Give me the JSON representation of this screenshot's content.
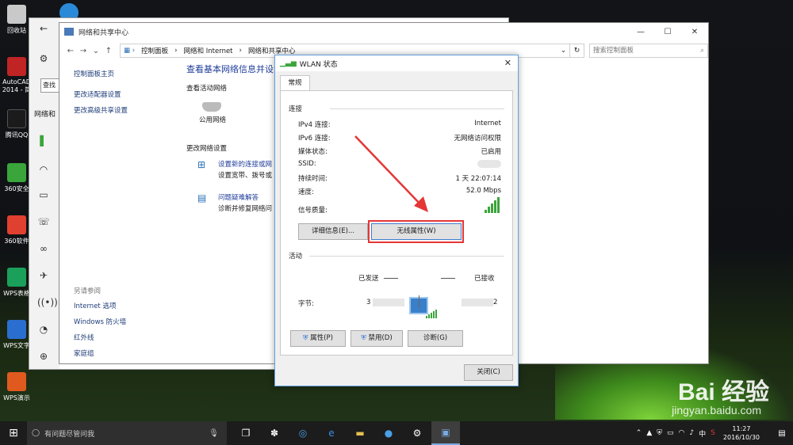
{
  "desktop": {
    "icons": [
      {
        "label": "回收站",
        "color": "#c9c9c9"
      },
      {
        "label": "AutoCAD 2014 - 简",
        "color": "#c02424"
      },
      {
        "label": "腾讯QQ",
        "color": "#1b1b1b"
      },
      {
        "label": "360安全",
        "color": "#3aa53a"
      },
      {
        "label": "360软件",
        "color": "#e04030"
      },
      {
        "label": "WPS表格",
        "color": "#1aa05a"
      },
      {
        "label": "WPS文字",
        "color": "#2a6fd0"
      },
      {
        "label": "WPS演示",
        "color": "#e05a20"
      }
    ],
    "watermark": "Bai 经验",
    "watermark_sub": "jingyan.baidu.com"
  },
  "settings_window": {
    "search_button": "查找",
    "side_label": "网络和"
  },
  "network_center": {
    "title": "网络和共享中心",
    "address": [
      "控制面板",
      "网络和 Internet",
      "网络和共享中心"
    ],
    "search_placeholder": "搜索控制面板",
    "left_links": [
      "控制面板主页",
      "更改适配器设置",
      "更改高级共享设置"
    ],
    "see_also_label": "另请参阅",
    "see_also_links": [
      "Internet 选项",
      "Windows 防火墙",
      "红外线",
      "家庭组"
    ],
    "heading": "查看基本网络信息并设",
    "active_networks": "查看活动网络",
    "public_network": "公用网络",
    "change_settings": "更改网络设置",
    "task1_link": "设置新的连接或网",
    "task1_desc": "设置宽带、拨号或",
    "task2_link": "问题疑难解答",
    "task2_desc": "诊断并修复网络问"
  },
  "wlan_dialog": {
    "title": "WLAN 状态",
    "tab": "常规",
    "connection_group": "连接",
    "rows": [
      {
        "k": "IPv4 连接:",
        "v": "Internet"
      },
      {
        "k": "IPv6 连接:",
        "v": "无网络访问权限"
      },
      {
        "k": "媒体状态:",
        "v": "已启用"
      },
      {
        "k": "SSID:",
        "v": ""
      },
      {
        "k": "持续时间:",
        "v": "1 天 22:07:14"
      },
      {
        "k": "速度:",
        "v": "52.0 Mbps"
      }
    ],
    "signal_label": "信号质量:",
    "signal_level": 5,
    "details_button": "详细信息(E)...",
    "wireless_props_button": "无线属性(W)",
    "activity_group": "活动",
    "sent_label": "已发送",
    "received_label": "已接收",
    "bytes_label": "字节:",
    "bytes_sent": "3",
    "bytes_received": "2",
    "properties_button": "属性(P)",
    "disable_button": "禁用(D)",
    "diagnose_button": "诊断(G)",
    "close_button": "关闭(C)"
  },
  "taskbar": {
    "search_placeholder": "有问题尽管问我",
    "ime": "中",
    "time": "11:27",
    "date": "2016/10/30"
  },
  "colors": {
    "accent_border": "#62a1e2",
    "highlight_red": "#e53636",
    "link_blue": "#1e3c9a",
    "signal_green": "#3aa53a"
  }
}
